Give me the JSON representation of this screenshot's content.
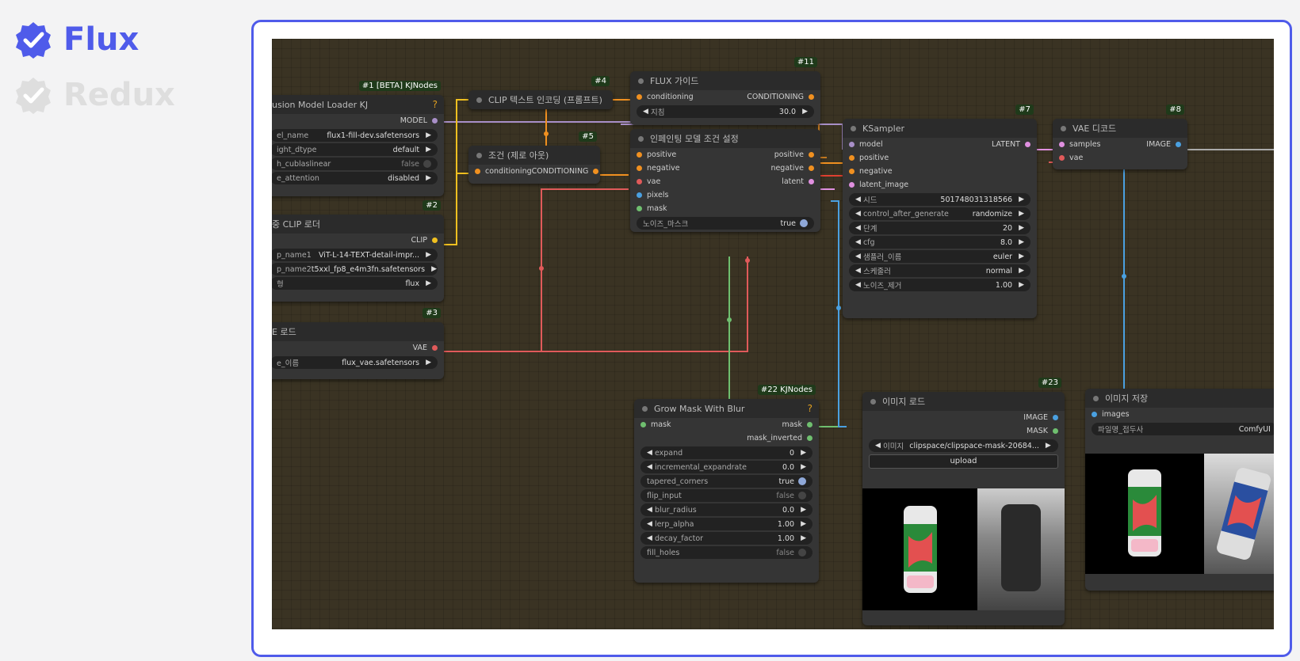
{
  "options": {
    "flux": {
      "label": "Flux",
      "color": "#4f5bea",
      "selected": true
    },
    "redux": {
      "label": "Redux",
      "color": "#dedede",
      "selected": false
    }
  },
  "colors": {
    "frame_border": "#4f5bea",
    "canvas_bg": "#3a3323"
  },
  "nodes": {
    "n1": {
      "badge": "#1 [BETA] KJNodes",
      "title": "usion Model Loader KJ",
      "out": "MODEL",
      "widgets": [
        {
          "label": "el_name",
          "value": "flux1-fill-dev.safetensors"
        },
        {
          "label": "ight_dtype",
          "value": "default"
        },
        {
          "label": "h_cublaslinear",
          "value": "false"
        },
        {
          "label": "e_attention",
          "value": "disabled"
        }
      ]
    },
    "n2": {
      "badge": "#2",
      "title": "중 CLIP 로더",
      "out": "CLIP",
      "widgets": [
        {
          "label": "p_name1",
          "value": "ViT-L-14-TEXT-detail-impr..."
        },
        {
          "label": "p_name2",
          "value": "t5xxl_fp8_e4m3fn.safetensors"
        },
        {
          "label": "형",
          "value": "flux"
        }
      ]
    },
    "n3": {
      "badge": "#3",
      "title": "E 로드",
      "out": "VAE",
      "widgets": [
        {
          "label": "e_이름",
          "value": "flux_vae.safetensors"
        }
      ]
    },
    "n4": {
      "badge": "#4",
      "title": "CLIP 텍스트 인코딩 (프롬프트)"
    },
    "n5": {
      "badge": "#5",
      "title": "조건 (제로 아웃)",
      "in": "conditioning",
      "out": "CONDITIONING"
    },
    "n11": {
      "badge": "#11",
      "title": "FLUX 가이드",
      "in": "conditioning",
      "out": "CONDITIONING",
      "widgets": [
        {
          "label": "지침",
          "value": "30.0"
        }
      ]
    },
    "n6": {
      "title": "인페인팅 모델 조건 설정",
      "inputs": [
        "positive",
        "negative",
        "vae",
        "pixels",
        "mask"
      ],
      "outputs": [
        "positive",
        "negative",
        "latent"
      ],
      "widgets": [
        {
          "label": "노이즈_마스크",
          "value": "true"
        }
      ]
    },
    "n7": {
      "badge": "#7",
      "title": "KSampler",
      "inputs": [
        "model",
        "positive",
        "negative",
        "latent_image"
      ],
      "out": "LATENT",
      "widgets": [
        {
          "label": "시드",
          "value": "501748031318566"
        },
        {
          "label": "control_after_generate",
          "value": "randomize"
        },
        {
          "label": "단계",
          "value": "20"
        },
        {
          "label": "cfg",
          "value": "8.0"
        },
        {
          "label": "샘플러_이름",
          "value": "euler"
        },
        {
          "label": "스케줄러",
          "value": "normal"
        },
        {
          "label": "노이즈_제거",
          "value": "1.00"
        }
      ]
    },
    "n8": {
      "badge": "#8",
      "title": "VAE 디코드",
      "inputs": [
        "samples",
        "vae"
      ],
      "out": "IMAGE"
    },
    "n22": {
      "badge": "#22 KJNodes",
      "title": "Grow Mask With Blur",
      "in": "mask",
      "outputs": [
        "mask",
        "mask_inverted"
      ],
      "widgets": [
        {
          "label": "expand",
          "value": "0"
        },
        {
          "label": "incremental_expandrate",
          "value": "0.0"
        },
        {
          "label": "tapered_corners",
          "value": "true"
        },
        {
          "label": "flip_input",
          "value": "false"
        },
        {
          "label": "blur_radius",
          "value": "0.0"
        },
        {
          "label": "lerp_alpha",
          "value": "1.00"
        },
        {
          "label": "decay_factor",
          "value": "1.00"
        },
        {
          "label": "fill_holes",
          "value": "false"
        }
      ]
    },
    "n23": {
      "badge": "#23",
      "title": "이미지 로드",
      "outputs": [
        "IMAGE",
        "MASK"
      ],
      "widgets": [
        {
          "label": "이미지",
          "value": "clipspace/clipspace-mask-20684..."
        }
      ],
      "button": "upload"
    },
    "n9": {
      "title": "이미지 저장",
      "in": "images",
      "widgets": [
        {
          "label": "파일명_접두사",
          "value": "ComfyUI"
        }
      ]
    }
  }
}
